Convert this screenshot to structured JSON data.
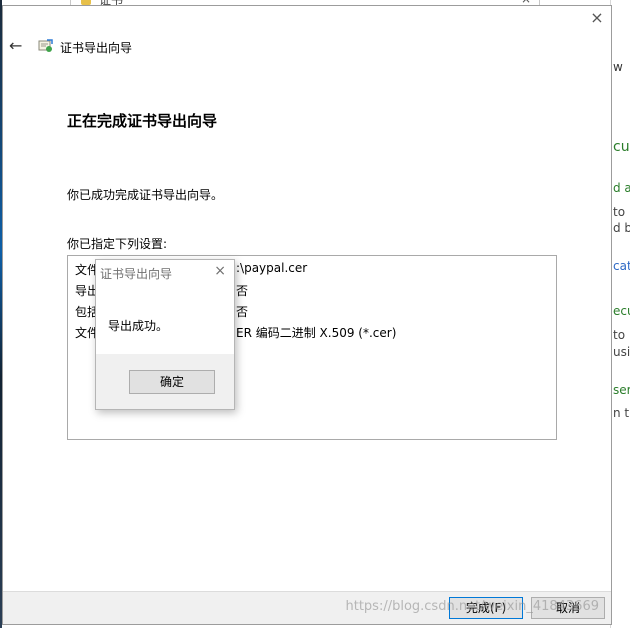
{
  "background": {
    "title": "证书",
    "close": "×",
    "right_fragments": [
      "w",
      "cur",
      "d a",
      "to",
      "d b",
      "cate",
      "ecu",
      "to",
      "usi",
      "ser",
      "n th"
    ]
  },
  "wizard": {
    "close_glyph": "×",
    "back_glyph": "←",
    "title": "证书导出向导",
    "heading": "正在完成证书导出向导",
    "success_message": "你已成功完成证书导出向导。",
    "settings_label": "你已指定下列设置:",
    "settings_rows": [
      {
        "label": "文件",
        "value": ":\\paypal.cer"
      },
      {
        "label": "导出",
        "value": "否"
      },
      {
        "label": "包括",
        "value": "否"
      },
      {
        "label": "文件",
        "value": "ER 编码二进制 X.509 (*.cer)"
      }
    ],
    "buttons": {
      "finish": "完成(F)",
      "cancel": "取消"
    },
    "watermark": "https://blog.csdn.net/weixin_41843669"
  },
  "popup": {
    "title": "证书导出向导",
    "close_glyph": "×",
    "message": "导出成功。",
    "ok_label": "确定"
  },
  "colors": {
    "accent": "#0078d7",
    "footer": "#f0f0f0"
  }
}
